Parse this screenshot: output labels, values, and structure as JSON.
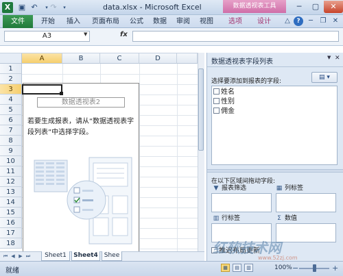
{
  "title_bar": {
    "window_title": "data.xlsx - Microsoft Excel",
    "context_tab_title": "数据透视表工具",
    "app_icon": "X"
  },
  "ribbon": {
    "file": "文件",
    "tabs": [
      "开始",
      "插入",
      "页面布局",
      "公式",
      "数据",
      "审阅",
      "视图"
    ],
    "context_tabs": [
      "选项",
      "设计"
    ]
  },
  "formula_bar": {
    "name_box": "A3",
    "fx": "fx",
    "formula": ""
  },
  "grid": {
    "columns": [
      "A",
      "B",
      "C",
      "D"
    ],
    "rows": [
      "1",
      "2",
      "3",
      "4",
      "5",
      "6",
      "7",
      "8",
      "9",
      "10",
      "11",
      "12",
      "13",
      "14",
      "15",
      "16",
      "17",
      "18"
    ],
    "selected_column": "A",
    "selected_row": "3"
  },
  "pivot_placeholder": {
    "name": "数据透视表2",
    "hint": "若要生成报表，请从“数据透视表字段列表”中选择字段。"
  },
  "sheet_tabs": [
    "Sheet1",
    "Sheet4",
    "Shee"
  ],
  "active_sheet": "Sheet4",
  "field_pane": {
    "title": "数据透视表字段列表",
    "choose_label": "选择要添加到报表的字段:",
    "fields": [
      "姓名",
      "性别",
      "佣金"
    ],
    "drag_label": "在以下区域间拖动字段:",
    "zones": {
      "report_filter": "报表筛选",
      "column_labels": "列标签",
      "row_labels": "行标签",
      "values": "数值"
    },
    "defer_update": "推迟布局更新"
  },
  "status": {
    "text": "就绪",
    "zoom": "100%"
  },
  "watermark": {
    "text": "红软技术网",
    "url": "www.52zj.com"
  }
}
